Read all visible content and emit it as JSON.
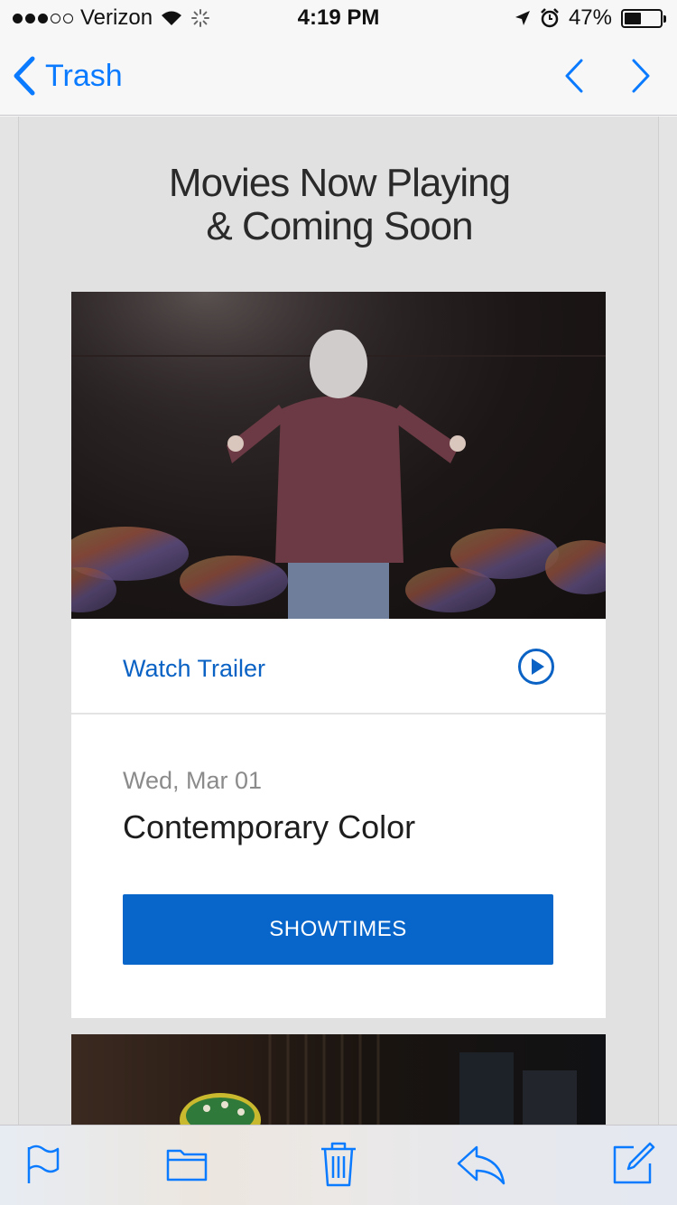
{
  "status_bar": {
    "carrier": "Verizon",
    "time": "4:19 PM",
    "battery": "47%",
    "battery_level": 0.47
  },
  "nav": {
    "back_label": "Trash",
    "icons": [
      "chevron-left-icon",
      "chevron-up-icon",
      "chevron-down-icon"
    ]
  },
  "email": {
    "headline_line1": "Movies Now Playing",
    "headline_line2": "& Coming Soon",
    "cards": [
      {
        "trailer_label": "Watch Trailer",
        "date": "Wed, Mar 01",
        "title": "Contemporary Color",
        "button_label": "SHOWTIMES"
      }
    ]
  },
  "toolbar": {
    "icons": [
      "flag-icon",
      "folder-icon",
      "trash-icon",
      "reply-icon",
      "compose-icon"
    ]
  },
  "colors": {
    "accent": "#0a7aff",
    "link": "#0a62c4",
    "button": "#0866cb"
  }
}
